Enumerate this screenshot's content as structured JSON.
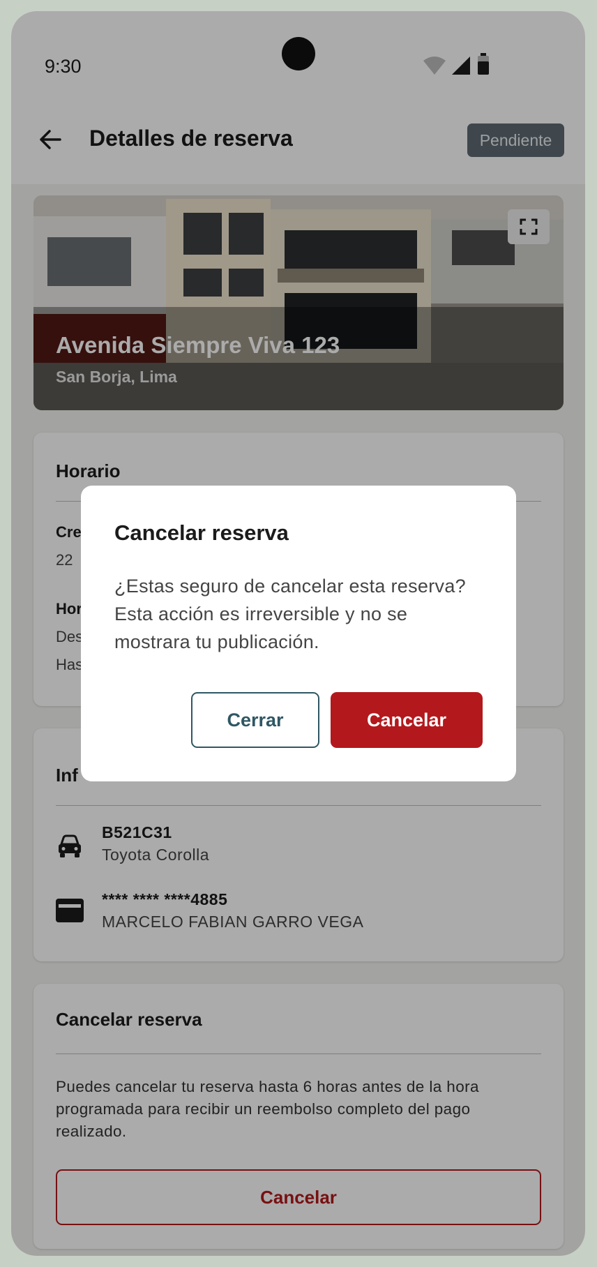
{
  "status_bar": {
    "time": "9:30"
  },
  "app_bar": {
    "title": "Detalles de reserva",
    "status_badge": "Pendiente"
  },
  "hero": {
    "address": "Avenida Siempre Viva 123",
    "district": "San Borja, Lima"
  },
  "schedule_card": {
    "title": "Horario",
    "created_label_partial": "Cre",
    "created_value_partial": "22",
    "hours_label_partial": "Hor",
    "from_partial": "Des",
    "to_partial": "Has"
  },
  "info_card": {
    "title_partial": "Inf",
    "vehicle": {
      "plate": "B521C31",
      "model": "Toyota Corolla",
      "icon": "car-icon"
    },
    "payment": {
      "card_number": "**** **** ****4885",
      "holder": "MARCELO FABIAN GARRO VEGA",
      "icon": "credit-card-icon"
    }
  },
  "cancel_card": {
    "title": "Cancelar reserva",
    "description": "Puedes cancelar tu reserva hasta 6 horas antes de la hora programada para recibir un reembolso completo del pago realizado.",
    "button": "Cancelar"
  },
  "dialog": {
    "title": "Cancelar reserva",
    "message": "¿Estas seguro de cancelar esta reserva? Esta acción es irreversible y no se mostrara tu publicación.",
    "close_button": "Cerrar",
    "confirm_button": "Cancelar"
  },
  "colors": {
    "primary_red": "#b3181c",
    "secondary_teal": "#2f5763",
    "badge_gray": "#5f6a73"
  }
}
